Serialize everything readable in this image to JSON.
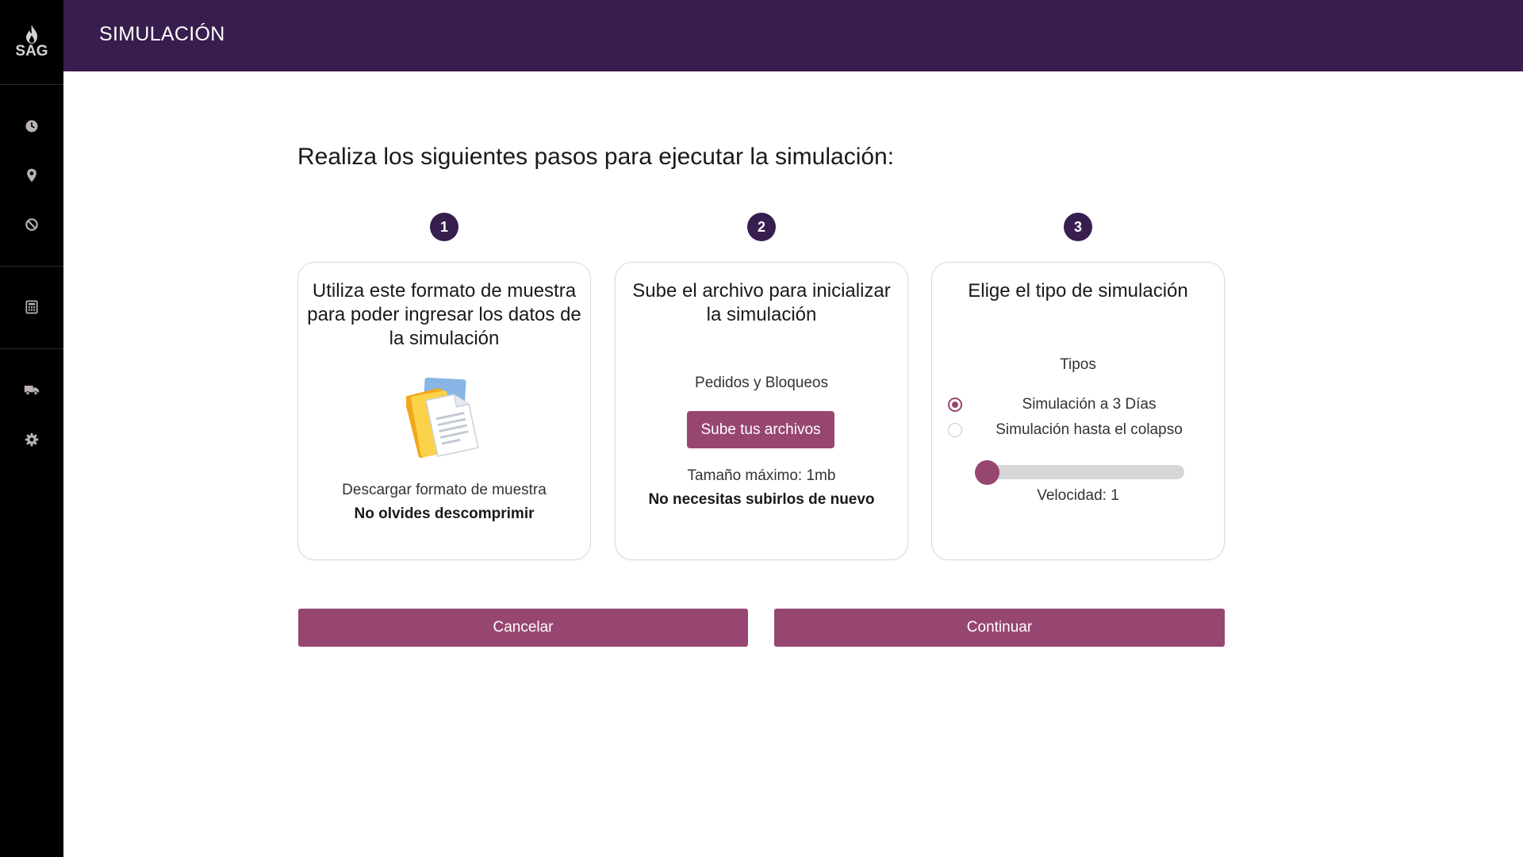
{
  "app": {
    "logo_text": "SAG",
    "page_title": "SIMULACIÓN"
  },
  "sidebar": {
    "items": [
      {
        "icon": "clock-icon"
      },
      {
        "icon": "location-pin-icon"
      },
      {
        "icon": "block-icon"
      },
      {
        "icon": "calculator-icon"
      },
      {
        "icon": "truck-icon"
      },
      {
        "icon": "gear-icon"
      }
    ]
  },
  "main": {
    "heading": "Realiza los siguientes pasos para ejecutar la simulación:"
  },
  "steps": [
    {
      "number": "1",
      "title": "Utiliza este formato de muestra para poder ingresar los datos de la simulación",
      "download_text": "Descargar formato de muestra",
      "note": "No olvides descomprimir"
    },
    {
      "number": "2",
      "title": "Sube el archivo para inicializar la simulación",
      "subtitle": "Pedidos y Bloqueos",
      "button": "Sube tus archivos",
      "max_size": "Tamaño máximo: 1mb",
      "note": "No necesitas subirlos de nuevo"
    },
    {
      "number": "3",
      "title": "Elige el tipo de simulación",
      "types_label": "Tipos",
      "options": [
        {
          "label": "Simulación a 3 Días",
          "selected": true
        },
        {
          "label": "Simulación hasta el colapso",
          "selected": false
        }
      ],
      "speed_label": "Velocidad: 1",
      "speed_level": 0
    }
  ],
  "actions": {
    "cancel": "Cancelar",
    "continue": "Continuar"
  },
  "colors": {
    "header_bg": "#371e4e",
    "accent": "#974672",
    "sidebar_bg": "#000000"
  }
}
